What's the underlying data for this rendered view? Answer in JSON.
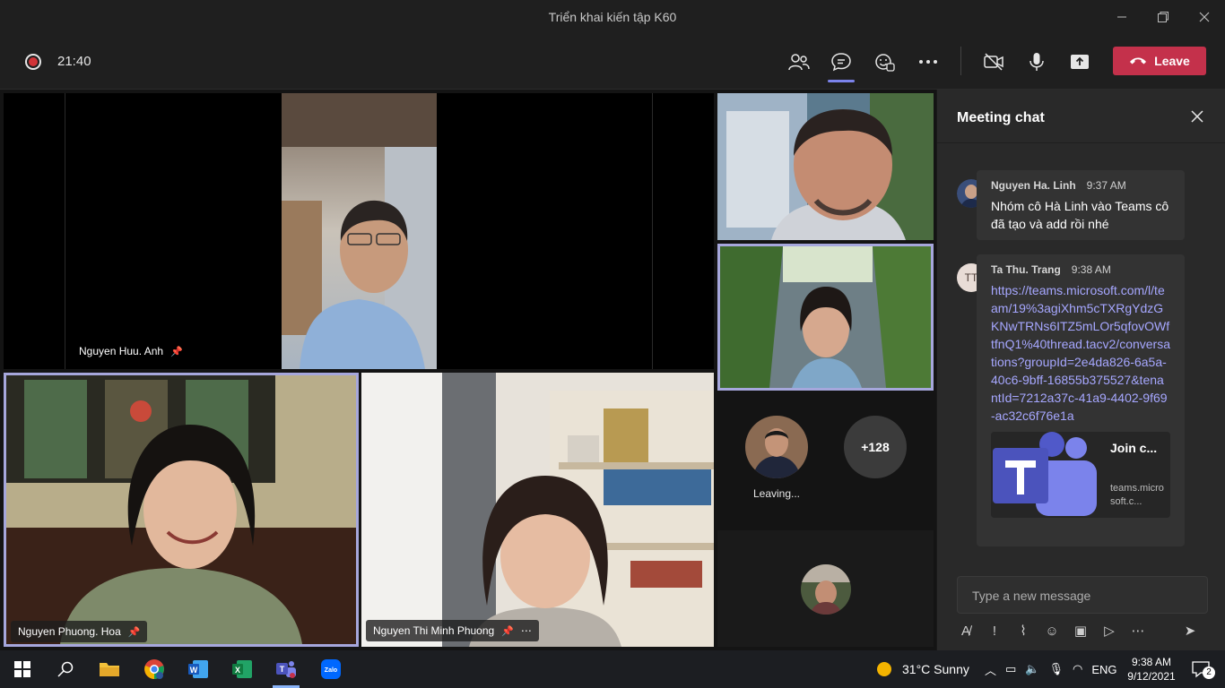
{
  "window": {
    "title": "Triển khai kiến tập K60"
  },
  "toolbar": {
    "timer": "21:40",
    "leave_label": "Leave"
  },
  "participants": {
    "main_top": {
      "name": "Nguyen Huu. Anh"
    },
    "bottom_left": {
      "name": "Nguyen Phuong. Hoa"
    },
    "bottom_right": {
      "name": "Nguyen Thi Minh Phuong"
    },
    "leaving_label": "Leaving...",
    "overflow_count": "+128"
  },
  "chat": {
    "title": "Meeting chat",
    "messages": [
      {
        "author": "Nguyen Ha. Linh",
        "time": "9:37 AM",
        "text": "Nhóm cô Hà Linh vào Teams cô đã tạo và add rồi nhé"
      },
      {
        "author": "Ta Thu. Trang",
        "initials": "TT",
        "time": "9:38 AM",
        "link": "https://teams.microsoft.com/l/team/19%3agiXhm5cTXRgYdzGKNwTRNs6ITZ5mLOr5qfovOWftfnQ1%40thread.tacv2/conversations?groupId=2e4da826-6a5a-40c6-9bff-16855b375527&tenantId=7212a37c-41a9-4402-9f69-ac32c6f76e1a",
        "card_title": "Join c...",
        "card_domain": "teams.microsoft.c..."
      }
    ],
    "compose_placeholder": "Type a new message"
  },
  "taskbar": {
    "weather": "31°C  Sunny",
    "language": "ENG",
    "time": "9:38 AM",
    "date": "9/12/2021",
    "notification_count": "2"
  },
  "colors": {
    "accent": "#7b83eb",
    "leave": "#c4314b",
    "link": "#a6a7ff"
  }
}
